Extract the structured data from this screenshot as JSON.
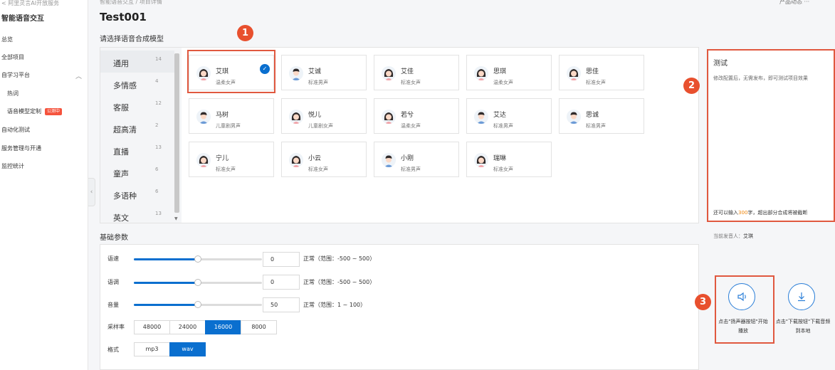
{
  "sidebar": {
    "back": "< 阿里灵言AI开放服务",
    "product": "智能语音交互",
    "items": [
      {
        "label": "总览"
      },
      {
        "label": "全部项目"
      },
      {
        "label": "自学习平台"
      },
      {
        "label": "热词"
      },
      {
        "label": "语音模型定制",
        "badge": "公测中"
      },
      {
        "label": "自动化测试"
      },
      {
        "label": "服务管理与开通"
      },
      {
        "label": "监控统计"
      }
    ]
  },
  "header": {
    "breadcrumb": "智能语音交互 / 项目详情",
    "top_right": "产品动态 ···",
    "title": "Test001"
  },
  "model_section": {
    "label": "请选择语音合成模型",
    "categories": [
      {
        "name": "通用",
        "count": "14"
      },
      {
        "name": "多情感",
        "count": "4"
      },
      {
        "name": "客服",
        "count": "12"
      },
      {
        "name": "超高清",
        "count": "2"
      },
      {
        "name": "直播",
        "count": "13"
      },
      {
        "name": "童声",
        "count": "6"
      },
      {
        "name": "多语种",
        "count": "6"
      },
      {
        "name": "英文",
        "count": "13"
      }
    ],
    "voices": [
      {
        "name": "艾琪",
        "desc": "温柔女声",
        "gender": "f",
        "selected": true
      },
      {
        "name": "艾诚",
        "desc": "标准男声",
        "gender": "m"
      },
      {
        "name": "艾佳",
        "desc": "标准女声",
        "gender": "f"
      },
      {
        "name": "思琪",
        "desc": "温柔女声",
        "gender": "f"
      },
      {
        "name": "思佳",
        "desc": "标准女声",
        "gender": "f"
      },
      {
        "name": "马树",
        "desc": "儿童剧男声",
        "gender": "m"
      },
      {
        "name": "悦儿",
        "desc": "儿童剧女声",
        "gender": "f"
      },
      {
        "name": "若兮",
        "desc": "温柔女声",
        "gender": "f"
      },
      {
        "name": "艾达",
        "desc": "标准男声",
        "gender": "m"
      },
      {
        "name": "思诚",
        "desc": "标准男声",
        "gender": "m"
      },
      {
        "name": "宁儿",
        "desc": "标准女声",
        "gender": "f"
      },
      {
        "name": "小云",
        "desc": "标准女声",
        "gender": "f"
      },
      {
        "name": "小刚",
        "desc": "标准男声",
        "gender": "m"
      },
      {
        "name": "瑞琳",
        "desc": "标准女声",
        "gender": "f"
      }
    ]
  },
  "params": {
    "label": "基础参数",
    "speed": {
      "label": "语速",
      "value": "0",
      "hint": "正常（范围：-500 ~ 500）",
      "level": 0.5
    },
    "pitch": {
      "label": "语调",
      "value": "0",
      "hint": "正常（范围：-500 ~ 500）",
      "level": 0.5
    },
    "volume": {
      "label": "音量",
      "value": "50",
      "hint": "正常（范围：1 ~ 100）",
      "level": 0.5
    },
    "sample_rate": {
      "label": "采样率",
      "options": [
        "48000",
        "24000",
        "16000",
        "8000"
      ],
      "selected": "16000"
    },
    "format": {
      "label": "格式",
      "options": [
        "mp3",
        "wav"
      ],
      "selected": "wav"
    }
  },
  "test": {
    "title": "测试",
    "desc": "修改配置后，无需发布，即可测试项目效果",
    "char_prefix": "还可以输入",
    "char_count": "300",
    "char_suffix": "字，超出部分合成将被截断",
    "speaker_prefix": "当前发音人：",
    "speaker_name": "艾琪",
    "play_label": "点击\"扬声器按钮\"开始播放",
    "download_label": "点击\"下载按钮\"下载音频到本地"
  },
  "markers": [
    "1",
    "2",
    "3"
  ],
  "colors": {
    "accent": "#0a6fcf",
    "highlight": "#e0583f",
    "marker": "#e8502e",
    "count_highlight": "#f0860d"
  }
}
